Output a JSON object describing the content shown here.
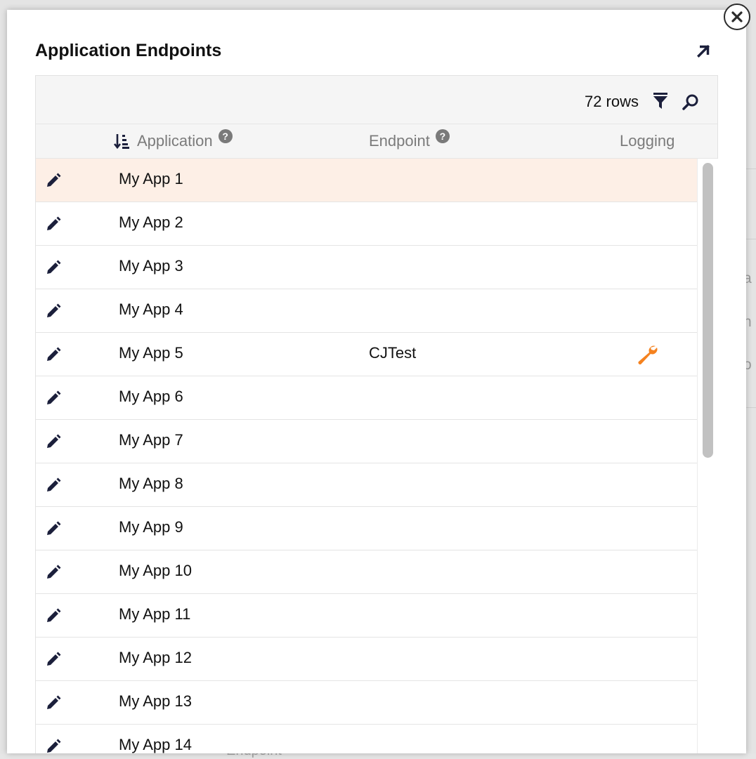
{
  "background": {
    "fragments": [
      "a",
      "n",
      "o"
    ],
    "ghost_label": "Endpoint"
  },
  "modal": {
    "title": "Application Endpoints",
    "close_icon": "close-icon",
    "expand_icon": "external-link-icon"
  },
  "toolbar": {
    "row_count": "72 rows",
    "filter_icon": "filter-icon",
    "search_icon": "search-icon"
  },
  "columns": {
    "application": "Application",
    "endpoint": "Endpoint",
    "logging": "Logging",
    "help_glyph": "?"
  },
  "rows": [
    {
      "application": "My App 1",
      "endpoint": "",
      "logging": false,
      "selected": true
    },
    {
      "application": "My App 2",
      "endpoint": "",
      "logging": false
    },
    {
      "application": "My App 3",
      "endpoint": "",
      "logging": false
    },
    {
      "application": "My App 4",
      "endpoint": "",
      "logging": false
    },
    {
      "application": "My App 5",
      "endpoint": "CJTest",
      "logging": true
    },
    {
      "application": "My App 6",
      "endpoint": "",
      "logging": false
    },
    {
      "application": "My App 7",
      "endpoint": "",
      "logging": false
    },
    {
      "application": "My App 8",
      "endpoint": "",
      "logging": false
    },
    {
      "application": "My App 9",
      "endpoint": "",
      "logging": false
    },
    {
      "application": "My App 10",
      "endpoint": "",
      "logging": false
    },
    {
      "application": "My App 11",
      "endpoint": "",
      "logging": false
    },
    {
      "application": "My App 12",
      "endpoint": "",
      "logging": false
    },
    {
      "application": "My App 13",
      "endpoint": "",
      "logging": false
    },
    {
      "application": "My App 14",
      "endpoint": "",
      "logging": false
    }
  ],
  "colors": {
    "selected_row": "#fdefe6",
    "icon_dark": "#1b1f3b",
    "wrench": "#f5821f"
  }
}
